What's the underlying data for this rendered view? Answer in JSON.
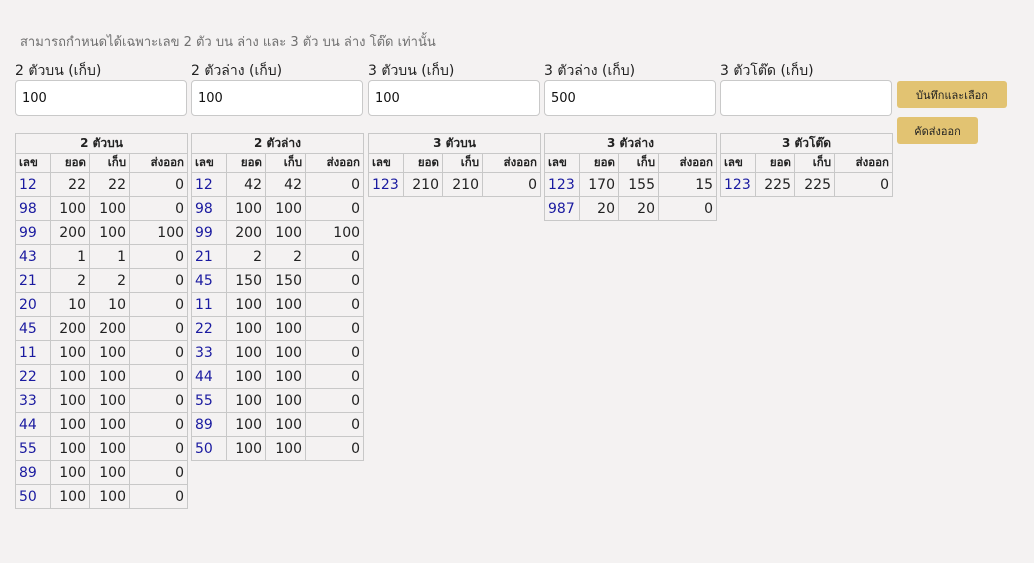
{
  "note": "สามารถกำหนดได้เฉพาะเลข 2 ตัว บน ล่าง และ 3 ตัว บน ล่าง โต๊ด เท่านั้น",
  "fields": [
    {
      "label": "2 ตัวบน (เก็บ)",
      "value": "100"
    },
    {
      "label": "2 ตัวล่าง (เก็บ)",
      "value": "100"
    },
    {
      "label": "3 ตัวบน (เก็บ)",
      "value": "100"
    },
    {
      "label": "3 ตัวล่าง (เก็บ)",
      "value": "500"
    },
    {
      "label": "3 ตัวโต๊ด (เก็บ)",
      "value": ""
    }
  ],
  "buttons": {
    "save": "บันทึกและเลือก",
    "export": "คัดส่งออก"
  },
  "columns": [
    "เลข",
    "ยอด",
    "เก็บ",
    "ส่งออก"
  ],
  "tables": [
    {
      "title": "2 ตัวบน",
      "rows": [
        [
          "12",
          "22",
          "22",
          "0"
        ],
        [
          "98",
          "100",
          "100",
          "0"
        ],
        [
          "99",
          "200",
          "100",
          "100"
        ],
        [
          "43",
          "1",
          "1",
          "0"
        ],
        [
          "21",
          "2",
          "2",
          "0"
        ],
        [
          "20",
          "10",
          "10",
          "0"
        ],
        [
          "45",
          "200",
          "200",
          "0"
        ],
        [
          "11",
          "100",
          "100",
          "0"
        ],
        [
          "22",
          "100",
          "100",
          "0"
        ],
        [
          "33",
          "100",
          "100",
          "0"
        ],
        [
          "44",
          "100",
          "100",
          "0"
        ],
        [
          "55",
          "100",
          "100",
          "0"
        ],
        [
          "89",
          "100",
          "100",
          "0"
        ],
        [
          "50",
          "100",
          "100",
          "0"
        ]
      ]
    },
    {
      "title": "2 ตัวล่าง",
      "rows": [
        [
          "12",
          "42",
          "42",
          "0"
        ],
        [
          "98",
          "100",
          "100",
          "0"
        ],
        [
          "99",
          "200",
          "100",
          "100"
        ],
        [
          "21",
          "2",
          "2",
          "0"
        ],
        [
          "45",
          "150",
          "150",
          "0"
        ],
        [
          "11",
          "100",
          "100",
          "0"
        ],
        [
          "22",
          "100",
          "100",
          "0"
        ],
        [
          "33",
          "100",
          "100",
          "0"
        ],
        [
          "44",
          "100",
          "100",
          "0"
        ],
        [
          "55",
          "100",
          "100",
          "0"
        ],
        [
          "89",
          "100",
          "100",
          "0"
        ],
        [
          "50",
          "100",
          "100",
          "0"
        ]
      ]
    },
    {
      "title": "3 ตัวบน",
      "rows": [
        [
          "123",
          "210",
          "210",
          "0"
        ]
      ]
    },
    {
      "title": "3 ตัวล่าง",
      "rows": [
        [
          "123",
          "170",
          "155",
          "15"
        ],
        [
          "987",
          "20",
          "20",
          "0"
        ]
      ]
    },
    {
      "title": "3 ตัวโต๊ด",
      "rows": [
        [
          "123",
          "225",
          "225",
          "0"
        ]
      ]
    }
  ]
}
